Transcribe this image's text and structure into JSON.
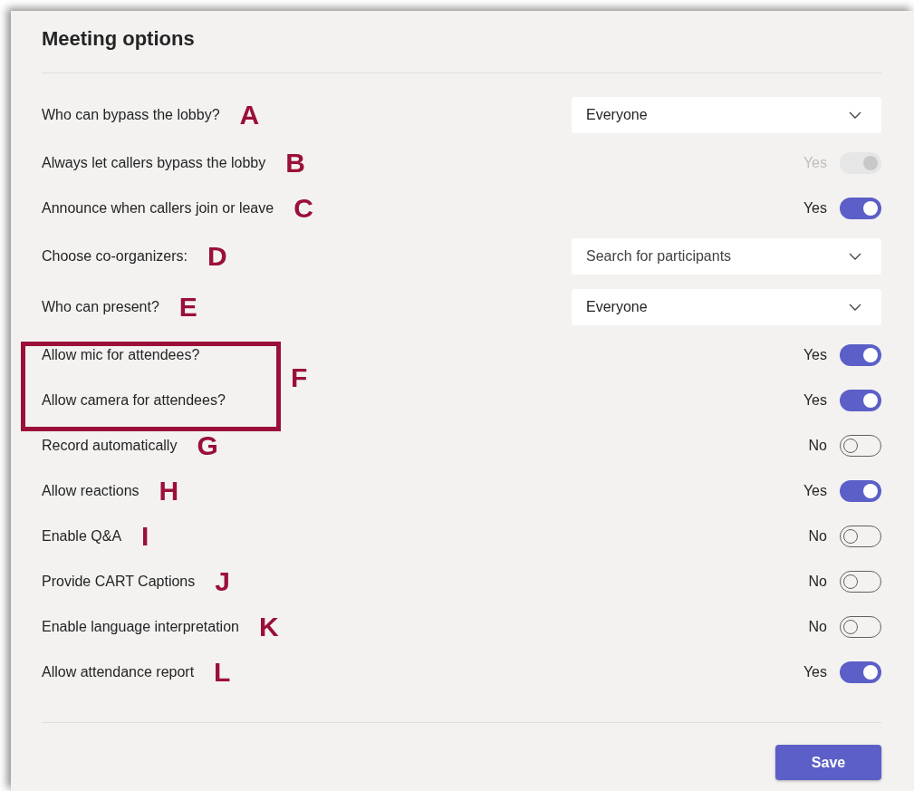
{
  "title": "Meeting options",
  "rows": [
    {
      "kind": "dropdown",
      "label": "Who can bypass the lobby?",
      "annotation": "A",
      "value": "Everyone"
    },
    {
      "kind": "toggle",
      "label": "Always let callers bypass the lobby",
      "annotation": "B",
      "reading": "Yes",
      "on": true,
      "disabled": true
    },
    {
      "kind": "toggle",
      "label": "Announce when callers join or leave",
      "annotation": "C",
      "reading": "Yes",
      "on": true,
      "disabled": false
    },
    {
      "kind": "dropdown",
      "label": "Choose co-organizers:",
      "annotation": "D",
      "placeholder": "Search for participants"
    },
    {
      "kind": "dropdown",
      "label": "Who can present?",
      "annotation": "E",
      "value": "Everyone"
    },
    {
      "kind": "group",
      "annotation": "F",
      "children": [
        {
          "kind": "toggle",
          "label": "Allow mic for attendees?",
          "reading": "Yes",
          "on": true,
          "disabled": false
        },
        {
          "kind": "toggle",
          "label": "Allow camera for attendees?",
          "reading": "Yes",
          "on": true,
          "disabled": false
        }
      ]
    },
    {
      "kind": "toggle",
      "label": "Record automatically",
      "annotation": "G",
      "reading": "No",
      "on": false,
      "disabled": false
    },
    {
      "kind": "toggle",
      "label": "Allow reactions",
      "annotation": "H",
      "reading": "Yes",
      "on": true,
      "disabled": false
    },
    {
      "kind": "toggle",
      "label": "Enable Q&A",
      "annotation": "I",
      "reading": "No",
      "on": false,
      "disabled": false
    },
    {
      "kind": "toggle",
      "label": "Provide CART Captions",
      "annotation": "J",
      "reading": "No",
      "on": false,
      "disabled": false
    },
    {
      "kind": "toggle",
      "label": "Enable language interpretation",
      "annotation": "K",
      "reading": "No",
      "on": false,
      "disabled": false
    },
    {
      "kind": "toggle",
      "label": "Allow attendance report",
      "annotation": "L",
      "reading": "Yes",
      "on": true,
      "disabled": false
    }
  ],
  "save_button": "Save"
}
